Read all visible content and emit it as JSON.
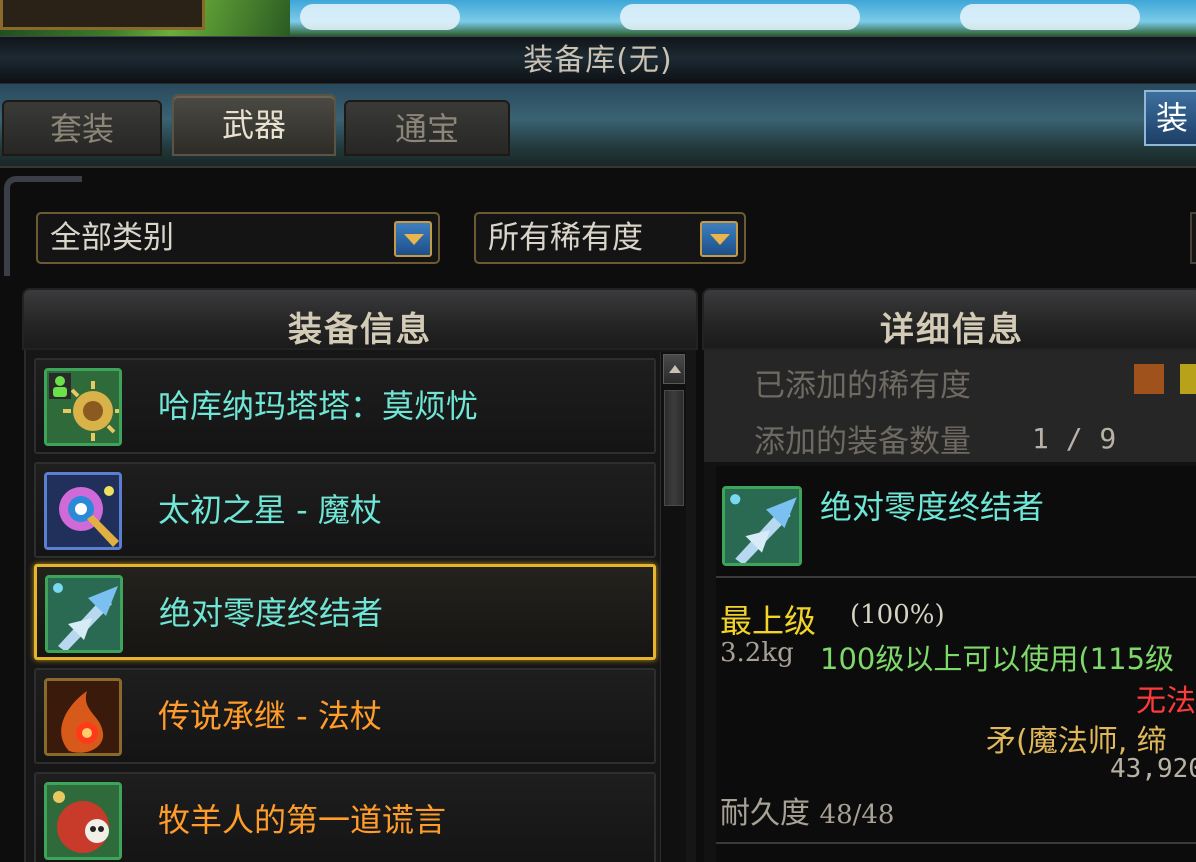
{
  "window": {
    "title": "装备库(无)"
  },
  "tabs": [
    {
      "label": "套装",
      "active": false
    },
    {
      "label": "武器",
      "active": true
    },
    {
      "label": "通宝",
      "active": false
    }
  ],
  "equip_button": {
    "label": "装"
  },
  "filters": {
    "category": "全部类别",
    "rarity": "所有稀有度"
  },
  "list_panel": {
    "header": "装备信息",
    "items": [
      {
        "name": "哈库纳玛塔塔：莫烦忧",
        "color": "#6fe6d6",
        "icon": "sun-creature-icon",
        "selected": false
      },
      {
        "name": "太初之星 - 魔杖",
        "color": "#6fe6d6",
        "icon": "star-wand-icon",
        "selected": false
      },
      {
        "name": "绝对零度终结者",
        "color": "#6fe6d6",
        "icon": "ice-spear-icon",
        "selected": true
      },
      {
        "name": "传说承继 - 法杖",
        "color": "#ff9c2a",
        "icon": "flame-staff-icon",
        "selected": false
      },
      {
        "name": "牧羊人的第一道谎言",
        "color": "#ff9c2a",
        "icon": "skull-creature-icon",
        "selected": false
      }
    ]
  },
  "detail_panel": {
    "header": "详细信息",
    "added_rarity_label": "已添加的稀有度",
    "added_count_label": "添加的装备数量",
    "added_count_value": "1 / 9",
    "rarity_swatches": [
      "#a0521d",
      "#b8a21a"
    ],
    "item": {
      "name": "绝对零度终结者",
      "grade": "最上级",
      "grade_percent": "(100%)",
      "weight": "3.2kg",
      "level_req": "100级以上可以使用(115级",
      "unusable": "无法",
      "type": "矛(魔法师, 缔",
      "price": "43,920",
      "durability_label": "耐久度",
      "durability_value": "48/48"
    }
  }
}
